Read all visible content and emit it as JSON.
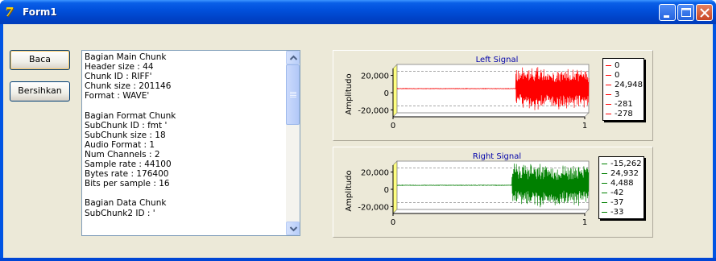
{
  "window": {
    "title": "Form1",
    "controls": {
      "minimize": "minimize-icon",
      "maximize": "maximize-icon",
      "close": "close-icon"
    }
  },
  "buttons": {
    "read": "Baca",
    "clear": "Bersihkan"
  },
  "memo_lines": [
    "Bagian Main Chunk",
    "Header size : 44",
    "Chunk ID : RIFF'",
    "Chunk size : 201146",
    "Format : WAVE'",
    "",
    "Bagian Format Chunk",
    "SubChunk ID : fmt '",
    "SubChunk size : 18",
    "Audio Format : 1",
    "Num Channels : 2",
    "Sample rate : 44100",
    "Bytes rate : 176400",
    "Bits per sample : 16",
    "",
    "Bagian Data Chunk",
    "SubChunk2 ID : '"
  ],
  "chart_data": [
    {
      "type": "line",
      "title": "Left Signal",
      "ylabel": "Amplitudo",
      "xlabel": "",
      "yticks": [
        "20,000",
        "0",
        "-20,000"
      ],
      "xticks": [
        "0",
        "1"
      ],
      "ylim": [
        -28000,
        28000
      ],
      "xlim": [
        0,
        1
      ],
      "grid": true,
      "color": "#ff0000",
      "signal": {
        "quiet_until": 0.62,
        "amplitude_after": 27000
      },
      "legend": [
        "0",
        "0",
        "24,948",
        "3",
        "-281",
        "-278"
      ]
    },
    {
      "type": "line",
      "title": "Right Signal",
      "ylabel": "Amplitudo",
      "xlabel": "",
      "yticks": [
        "20,000",
        "0",
        "-20,000"
      ],
      "xticks": [
        "0",
        "1"
      ],
      "ylim": [
        -28000,
        28000
      ],
      "xlim": [
        0,
        1
      ],
      "grid": true,
      "color": "#008000",
      "signal": {
        "quiet_until": 0.6,
        "amplitude_after": 27000
      },
      "legend": [
        "-15,262",
        "24,932",
        "4,488",
        "-42",
        "-37",
        "-33"
      ]
    }
  ],
  "colors": {
    "title_blue": "#0000aa",
    "face": "#ece9d8"
  }
}
